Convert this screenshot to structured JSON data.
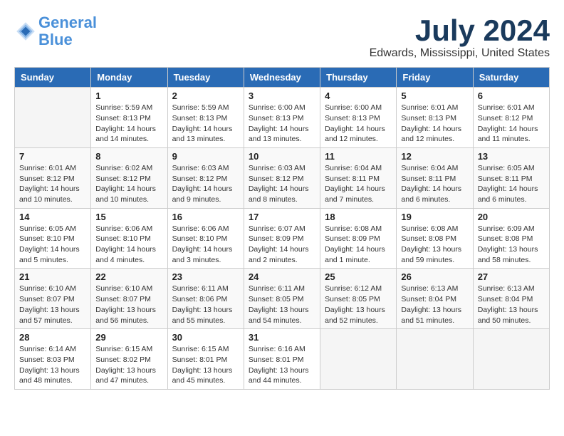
{
  "header": {
    "logo_line1": "General",
    "logo_line2": "Blue",
    "month_year": "July 2024",
    "location": "Edwards, Mississippi, United States"
  },
  "weekdays": [
    "Sunday",
    "Monday",
    "Tuesday",
    "Wednesday",
    "Thursday",
    "Friday",
    "Saturday"
  ],
  "weeks": [
    [
      {
        "day": "",
        "info": ""
      },
      {
        "day": "1",
        "info": "Sunrise: 5:59 AM\nSunset: 8:13 PM\nDaylight: 14 hours\nand 14 minutes."
      },
      {
        "day": "2",
        "info": "Sunrise: 5:59 AM\nSunset: 8:13 PM\nDaylight: 14 hours\nand 13 minutes."
      },
      {
        "day": "3",
        "info": "Sunrise: 6:00 AM\nSunset: 8:13 PM\nDaylight: 14 hours\nand 13 minutes."
      },
      {
        "day": "4",
        "info": "Sunrise: 6:00 AM\nSunset: 8:13 PM\nDaylight: 14 hours\nand 12 minutes."
      },
      {
        "day": "5",
        "info": "Sunrise: 6:01 AM\nSunset: 8:13 PM\nDaylight: 14 hours\nand 12 minutes."
      },
      {
        "day": "6",
        "info": "Sunrise: 6:01 AM\nSunset: 8:12 PM\nDaylight: 14 hours\nand 11 minutes."
      }
    ],
    [
      {
        "day": "7",
        "info": "Sunrise: 6:01 AM\nSunset: 8:12 PM\nDaylight: 14 hours\nand 10 minutes."
      },
      {
        "day": "8",
        "info": "Sunrise: 6:02 AM\nSunset: 8:12 PM\nDaylight: 14 hours\nand 10 minutes."
      },
      {
        "day": "9",
        "info": "Sunrise: 6:03 AM\nSunset: 8:12 PM\nDaylight: 14 hours\nand 9 minutes."
      },
      {
        "day": "10",
        "info": "Sunrise: 6:03 AM\nSunset: 8:12 PM\nDaylight: 14 hours\nand 8 minutes."
      },
      {
        "day": "11",
        "info": "Sunrise: 6:04 AM\nSunset: 8:11 PM\nDaylight: 14 hours\nand 7 minutes."
      },
      {
        "day": "12",
        "info": "Sunrise: 6:04 AM\nSunset: 8:11 PM\nDaylight: 14 hours\nand 6 minutes."
      },
      {
        "day": "13",
        "info": "Sunrise: 6:05 AM\nSunset: 8:11 PM\nDaylight: 14 hours\nand 6 minutes."
      }
    ],
    [
      {
        "day": "14",
        "info": "Sunrise: 6:05 AM\nSunset: 8:10 PM\nDaylight: 14 hours\nand 5 minutes."
      },
      {
        "day": "15",
        "info": "Sunrise: 6:06 AM\nSunset: 8:10 PM\nDaylight: 14 hours\nand 4 minutes."
      },
      {
        "day": "16",
        "info": "Sunrise: 6:06 AM\nSunset: 8:10 PM\nDaylight: 14 hours\nand 3 minutes."
      },
      {
        "day": "17",
        "info": "Sunrise: 6:07 AM\nSunset: 8:09 PM\nDaylight: 14 hours\nand 2 minutes."
      },
      {
        "day": "18",
        "info": "Sunrise: 6:08 AM\nSunset: 8:09 PM\nDaylight: 14 hours\nand 1 minute."
      },
      {
        "day": "19",
        "info": "Sunrise: 6:08 AM\nSunset: 8:08 PM\nDaylight: 13 hours\nand 59 minutes."
      },
      {
        "day": "20",
        "info": "Sunrise: 6:09 AM\nSunset: 8:08 PM\nDaylight: 13 hours\nand 58 minutes."
      }
    ],
    [
      {
        "day": "21",
        "info": "Sunrise: 6:10 AM\nSunset: 8:07 PM\nDaylight: 13 hours\nand 57 minutes."
      },
      {
        "day": "22",
        "info": "Sunrise: 6:10 AM\nSunset: 8:07 PM\nDaylight: 13 hours\nand 56 minutes."
      },
      {
        "day": "23",
        "info": "Sunrise: 6:11 AM\nSunset: 8:06 PM\nDaylight: 13 hours\nand 55 minutes."
      },
      {
        "day": "24",
        "info": "Sunrise: 6:11 AM\nSunset: 8:05 PM\nDaylight: 13 hours\nand 54 minutes."
      },
      {
        "day": "25",
        "info": "Sunrise: 6:12 AM\nSunset: 8:05 PM\nDaylight: 13 hours\nand 52 minutes."
      },
      {
        "day": "26",
        "info": "Sunrise: 6:13 AM\nSunset: 8:04 PM\nDaylight: 13 hours\nand 51 minutes."
      },
      {
        "day": "27",
        "info": "Sunrise: 6:13 AM\nSunset: 8:04 PM\nDaylight: 13 hours\nand 50 minutes."
      }
    ],
    [
      {
        "day": "28",
        "info": "Sunrise: 6:14 AM\nSunset: 8:03 PM\nDaylight: 13 hours\nand 48 minutes."
      },
      {
        "day": "29",
        "info": "Sunrise: 6:15 AM\nSunset: 8:02 PM\nDaylight: 13 hours\nand 47 minutes."
      },
      {
        "day": "30",
        "info": "Sunrise: 6:15 AM\nSunset: 8:01 PM\nDaylight: 13 hours\nand 45 minutes."
      },
      {
        "day": "31",
        "info": "Sunrise: 6:16 AM\nSunset: 8:01 PM\nDaylight: 13 hours\nand 44 minutes."
      },
      {
        "day": "",
        "info": ""
      },
      {
        "day": "",
        "info": ""
      },
      {
        "day": "",
        "info": ""
      }
    ]
  ]
}
